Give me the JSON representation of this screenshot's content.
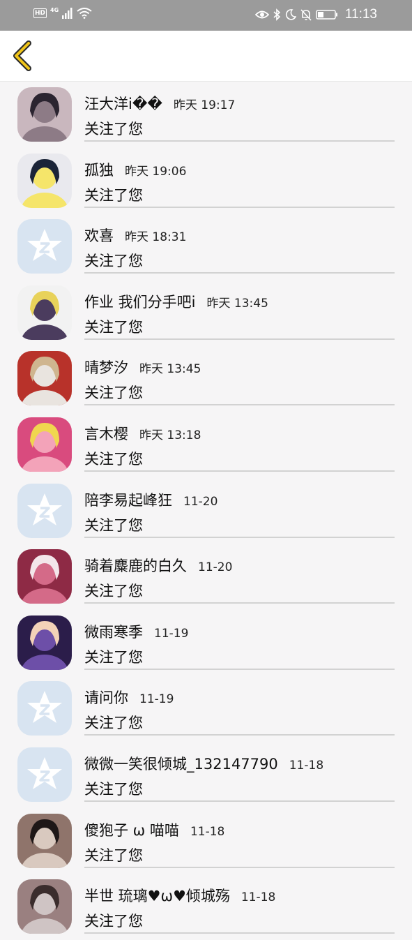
{
  "status_bar": {
    "network_badge": "HD",
    "network_type": "4G",
    "time": "11:13"
  },
  "nav": {
    "back_icon": "chevron-left-icon",
    "accent": "#f0c419"
  },
  "colors": {
    "default_avatar_bg": "#d8e4f1",
    "default_avatar_fg": "#ffffff"
  },
  "items": [
    {
      "name": "汪大洋i��",
      "time": "昨天 19:17",
      "action": "关注了您",
      "avatar": "photo",
      "avatar_colors": [
        "#8d7b86",
        "#2b2430",
        "#c9b7be"
      ]
    },
    {
      "name": "孤独",
      "time": "昨天 19:06",
      "action": "关注了您",
      "avatar": "photo",
      "avatar_colors": [
        "#f5e56a",
        "#1b2438",
        "#e9e9ee"
      ]
    },
    {
      "name": "欢喜",
      "time": "昨天 18:31",
      "action": "关注了您",
      "avatar": "default"
    },
    {
      "name": "作业 我们分手吧i",
      "time": "昨天 13:45",
      "action": "关注了您",
      "avatar": "photo",
      "avatar_colors": [
        "#4b3c5e",
        "#e8d25a",
        "#f2f2f2"
      ]
    },
    {
      "name": "晴梦汐",
      "time": "昨天 13:45",
      "action": "关注了您",
      "avatar": "photo",
      "avatar_colors": [
        "#e9e4df",
        "#cfb58f",
        "#b8322a"
      ]
    },
    {
      "name": "言木樱",
      "time": "昨天 13:18",
      "action": "关注了您",
      "avatar": "photo",
      "avatar_colors": [
        "#f3a3b9",
        "#f0d64f",
        "#d94b7e"
      ]
    },
    {
      "name": "陪李易起峰狂",
      "time": "11-20",
      "action": "关注了您",
      "avatar": "default"
    },
    {
      "name": "骑着麋鹿的白久",
      "time": "11-20",
      "action": "关注了您",
      "avatar": "photo",
      "avatar_colors": [
        "#d46a88",
        "#f3e6ea",
        "#8e2a45"
      ]
    },
    {
      "name": "微雨寒季",
      "time": "11-19",
      "action": "关注了您",
      "avatar": "photo",
      "avatar_colors": [
        "#6d4fa8",
        "#f3d2b8",
        "#2b1d4a"
      ]
    },
    {
      "name": "请问你",
      "time": "11-19",
      "action": "关注了您",
      "avatar": "default"
    },
    {
      "name": "微微一笑很倾城_132147790",
      "time": "11-18",
      "action": "关注了您",
      "avatar": "default"
    },
    {
      "name": "傻狍子 ω 喵喵",
      "time": "11-18",
      "action": "关注了您",
      "avatar": "photo",
      "avatar_colors": [
        "#d9c9bf",
        "#1e1717",
        "#8f746b"
      ]
    },
    {
      "name": "半世 琉璃♥ω♥倾城殇",
      "time": "11-18",
      "action": "关注了您",
      "avatar": "photo",
      "avatar_colors": [
        "#cfc4c4",
        "#3a2c2c",
        "#9a8080"
      ]
    }
  ]
}
